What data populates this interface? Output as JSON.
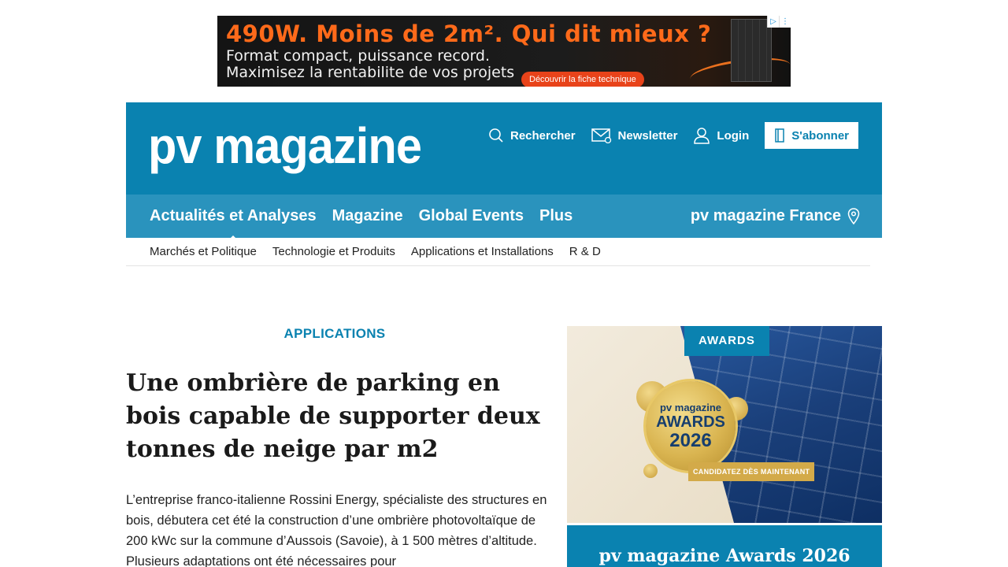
{
  "ad": {
    "headline": "490W. Moins de 2m². Qui dit mieux ?",
    "line1": "Format compact, puissance record.",
    "line2": "Maximisez la rentabilite de vos projets",
    "cta": "Découvrir la fiche technique"
  },
  "header": {
    "logo": "pv magazine",
    "search_label": "Rechercher",
    "newsletter_label": "Newsletter",
    "login_label": "Login",
    "subscribe_label": "S'abonner"
  },
  "nav": {
    "items": [
      {
        "label": "Actualités et Analyses",
        "active": true
      },
      {
        "label": "Magazine"
      },
      {
        "label": "Global Events"
      },
      {
        "label": "Plus"
      }
    ],
    "edition": "pv magazine France"
  },
  "subnav": {
    "items": [
      "Marchés et Politique",
      "Technologie et Produits",
      "Applications et Installations",
      "R & D"
    ]
  },
  "article": {
    "category": "APPLICATIONS",
    "title": "Une ombrière de parking en bois capable de supporter deux tonnes de neige par m2",
    "lead": "L’entreprise franco-italienne Rossini Energy, spécialiste des structures en bois, débutera cet été la construction d’une ombrière photovoltaïque de 200 kWc sur la commune d’Aussois (Savoie), à 1 500 mètres d’altitude. Plusieurs adaptations ont été nécessaires pour"
  },
  "promo": {
    "badge": "AWARDS",
    "medal_line1": "pv magazine",
    "medal_line2": "AWARDS",
    "medal_line3": "2026",
    "tag": "CANDIDATEZ DÈS MAINTENANT",
    "card_title": "pv magazine Awards 2026"
  },
  "colors": {
    "brand_blue": "#0a82b0",
    "nav_blue": "#2a93bd",
    "ad_orange": "#ff6a1a"
  }
}
